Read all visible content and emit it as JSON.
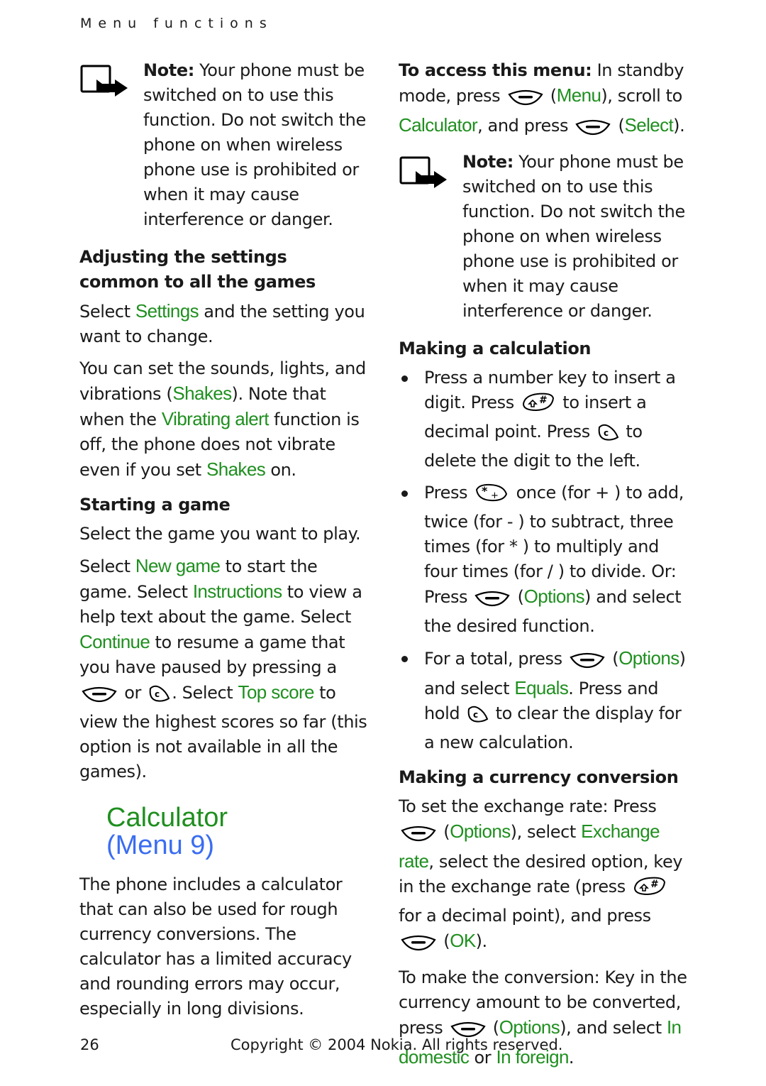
{
  "header": {
    "running_head": "Menu functions"
  },
  "left_column": {
    "note": {
      "label": "Note:",
      "text": " Your phone must be switched on to use this function. Do not switch the phone on when wireless phone use is prohibited or when it may cause interference or danger."
    },
    "settings_section": {
      "heading": "Adjusting the settings common to all the games",
      "p1": {
        "pre": "Select ",
        "ui": "Settings",
        "post": " and the setting you want to change."
      },
      "p2": {
        "a": "You can set the sounds, lights, and vibrations (",
        "ui1": "Shakes",
        "b": "). Note that when the ",
        "ui2": "Vibrating alert",
        "c": " function is off, the phone does not vibrate even if you set ",
        "ui3": "Shakes",
        "d": " on."
      }
    },
    "starting_section": {
      "heading": "Starting a game",
      "p1": "Select the game you want to play.",
      "p2": {
        "a": "Select ",
        "ui1": "New game",
        "b": " to start the game. Select ",
        "ui2": "Instructions",
        "c": " to view a help text about the game. Select ",
        "ui3": "Continue",
        "d": " to resume a game that you have paused by pressing a ",
        "e": " or ",
        "f": ". Select ",
        "ui4": "Top score",
        "g": " to view the highest scores so far (this option is not available in all the games)."
      }
    },
    "calculator_title": {
      "main": "Calculator",
      "sub": "(Menu 9)"
    },
    "calculator_intro": "The phone includes a calculator that can also be used for rough currency conversions. The calculator has a limited accuracy and rounding errors may occur, especially in long divisions."
  },
  "right_column": {
    "access": {
      "label": "To access this menu:",
      "a": " In standby mode, press ",
      "b": " (",
      "ui1": "Menu",
      "c": "), scroll to ",
      "ui2": "Calculator",
      "d": ", and press ",
      "e": " (",
      "ui3": "Select",
      "f": ")."
    },
    "note": {
      "label": "Note:",
      "text": " Your phone must be switched on to use this function. Do not switch the phone on when wireless phone use is prohibited or when it may cause interference or danger."
    },
    "calculation_section": {
      "heading": "Making a calculation",
      "bullet1": {
        "a": "Press a number key to insert a digit. Press ",
        "b": " to insert a decimal point. Press ",
        "c": " to delete the digit to the left."
      },
      "bullet2": {
        "a": "Press ",
        "b": " once (for + ) to add, twice (for - ) to subtract, three times (for * ) to multiply and four times (for / ) to divide. Or: Press ",
        "c": " (",
        "ui1": "Options",
        "d": ") and select the desired function."
      },
      "bullet3": {
        "a": "For a total, press ",
        "b": " (",
        "ui1": "Options",
        "c": ") and select ",
        "ui2": "Equals",
        "d": ". Press and hold ",
        "e": " to clear the display for a new calculation."
      }
    },
    "currency_section": {
      "heading": "Making a currency conversion",
      "p1": {
        "a": "To set the exchange rate: Press ",
        "b": " (",
        "ui1": "Options",
        "c": "), select ",
        "ui2": "Exchange rate",
        "d": ", select the desired option, key in the exchange rate (press ",
        "e": " for a decimal point), and press ",
        "f": " (",
        "ui3": "OK",
        "g": ")."
      },
      "p2": {
        "a": "To make the conversion: Key in the currency amount to be converted, press ",
        "b": " (",
        "ui1": "Options",
        "c": "), and select ",
        "ui2": "In domestic",
        "d": " or ",
        "ui3": "In foreign",
        "e": "."
      }
    }
  },
  "footer": {
    "page_number": "26",
    "copyright": "Copyright © 2004 Nokia. All rights reserved."
  },
  "colors": {
    "ui_text": "#1f8f1f",
    "menu_number": "#3a6df0",
    "body_text": "#1a1a1a"
  }
}
